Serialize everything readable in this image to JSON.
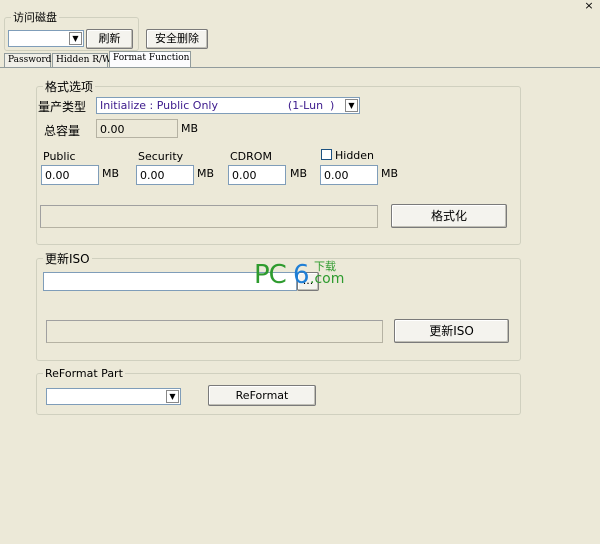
{
  "window": {
    "close_label": "×"
  },
  "disk": {
    "legend": "访问磁盘",
    "selected": "",
    "refresh_label": "刷新",
    "safe_remove_label": "安全删除"
  },
  "tabs": [
    {
      "label": "Password"
    },
    {
      "label": "Hidden R/W"
    },
    {
      "label": "Format Function"
    }
  ],
  "format_options": {
    "legend": "格式选项",
    "type_label": "量产类型",
    "type_value": "Initialize : Public Only                    (1-Lun  )",
    "total_label": "总容量",
    "total_value": "0.00",
    "total_unit": "MB",
    "public": {
      "label": "Public",
      "value": "0.00",
      "unit": "MB"
    },
    "security": {
      "label": "Security",
      "value": "0.00",
      "unit": "MB"
    },
    "cdrom": {
      "label": "CDROM",
      "value": "0.00",
      "unit": "MB"
    },
    "hidden": {
      "label": "Hidden",
      "value": "0.00",
      "unit": "MB",
      "checked": false
    },
    "format_button": "格式化"
  },
  "update_iso": {
    "legend": "更新ISO",
    "path_value": "",
    "browse_label": "...",
    "button": "更新ISO"
  },
  "reformat": {
    "legend": "ReFormat Part",
    "selected": "",
    "button": "ReFormat"
  },
  "watermark": {
    "pc": "PC",
    "six": "6",
    "xia": "下载",
    "com": ".com"
  },
  "colors": {
    "background": "#ece9d8",
    "combo_text": "#3c1a8c",
    "logo_green": "#2e9b2e",
    "logo_blue": "#1f7fd6"
  }
}
